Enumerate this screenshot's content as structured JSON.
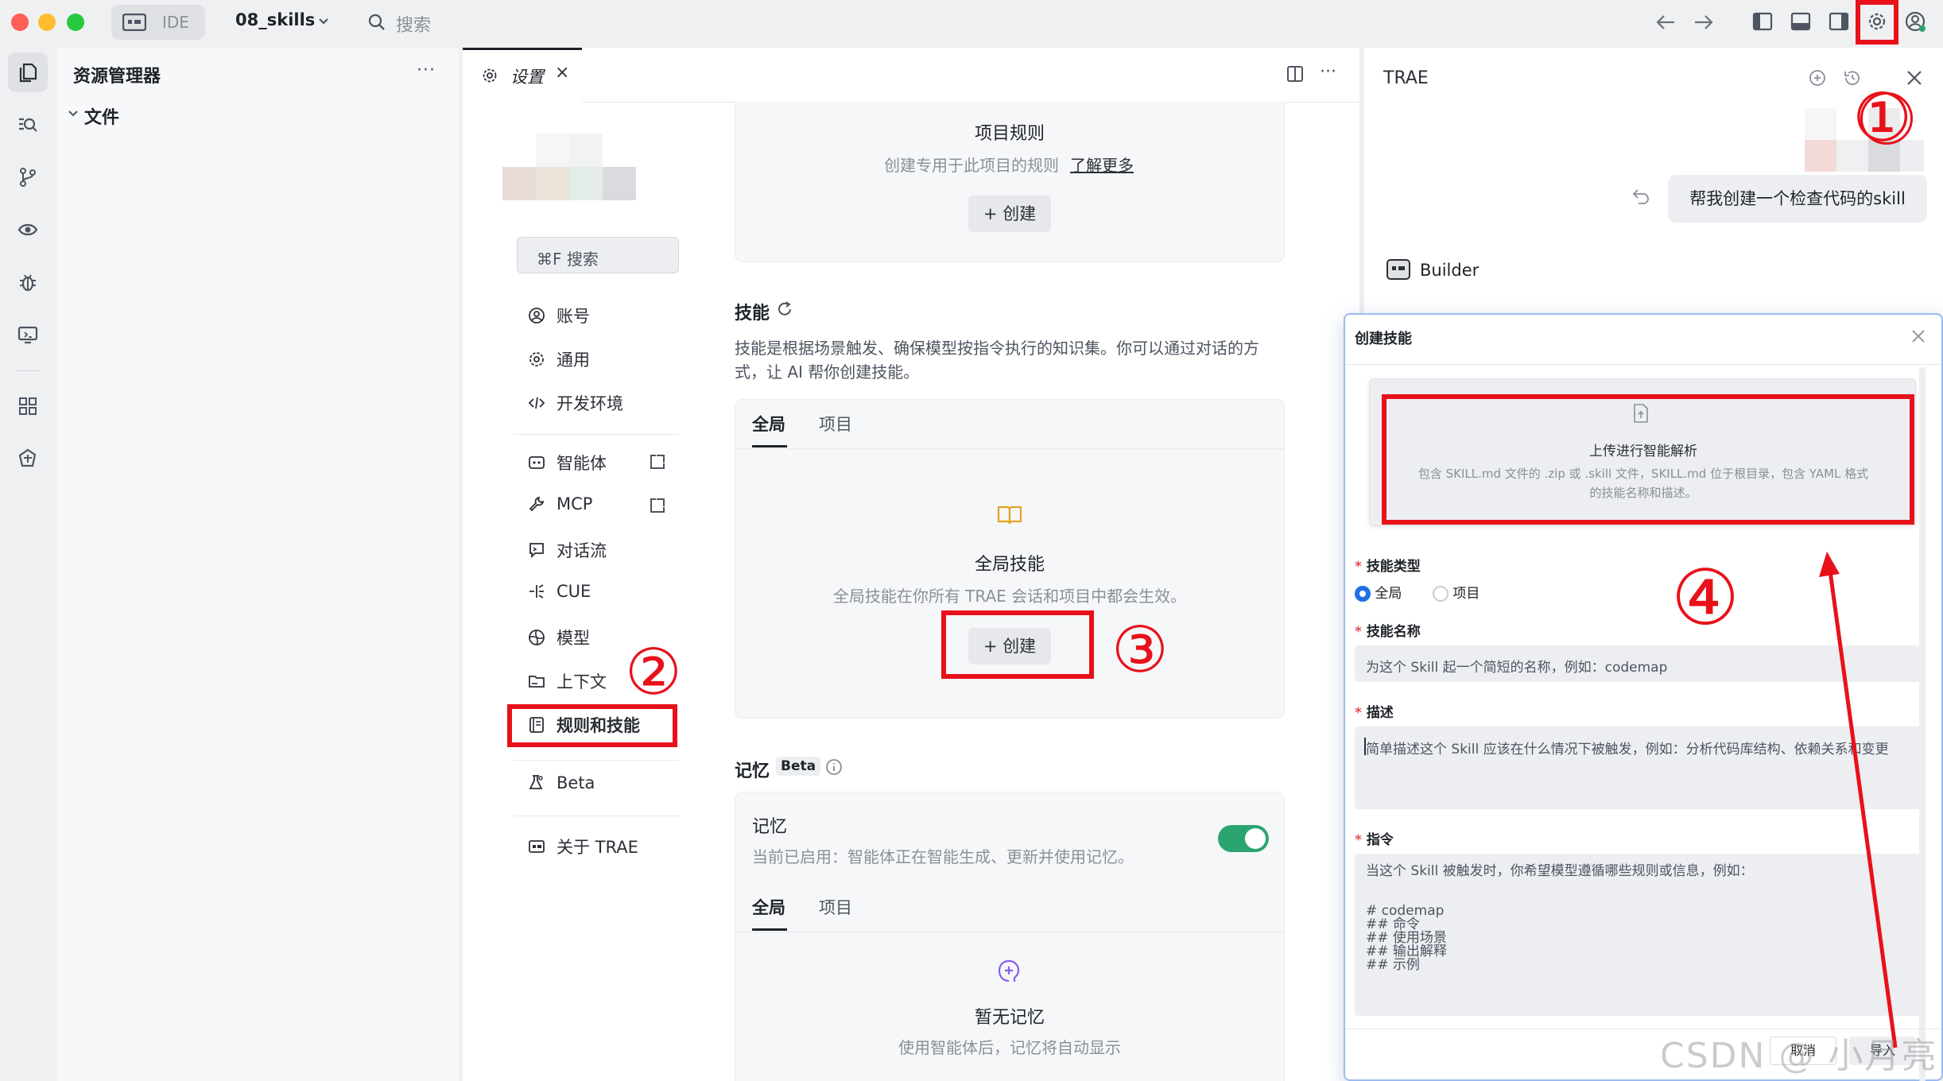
{
  "titlebar": {
    "mode_label": "IDE",
    "project_name": "08_skills",
    "search_placeholder": "搜索"
  },
  "explorer": {
    "title": "资源管理器",
    "more": "···",
    "folder": "文件"
  },
  "editor": {
    "tab_label": "设置",
    "tab_close": "×",
    "settings_search": "⌘F 搜索",
    "nav": [
      {
        "label": "账号",
        "icon": "user-icon"
      },
      {
        "label": "通用",
        "icon": "gear-icon"
      },
      {
        "label": "开发环境",
        "icon": "code-icon"
      },
      {
        "label": "智能体",
        "icon": "agent-icon"
      },
      {
        "label": "MCP",
        "icon": "wrench-icon"
      },
      {
        "label": "对话流",
        "icon": "chat-icon"
      },
      {
        "label": "CUE",
        "icon": "cue-icon"
      },
      {
        "label": "模型",
        "icon": "model-icon"
      },
      {
        "label": "上下文",
        "icon": "folder-icon"
      },
      {
        "label": "规则和技能",
        "icon": "rules-icon"
      },
      {
        "label": "Beta",
        "icon": "flask-icon"
      },
      {
        "label": "关于 TRAE",
        "icon": "info-icon"
      }
    ],
    "project_rules": {
      "title": "项目规则",
      "desc": "创建专用于此项目的规则",
      "learn_more": "了解更多",
      "create": "创建"
    },
    "skills": {
      "title": "技能",
      "desc_line1": "技能是根据场景触发、确保模型按指令执行的知识集。你可以通过对话的方",
      "desc_line2": "式，让 AI 帮你创建技能。",
      "tabs": [
        "全局",
        "项目"
      ],
      "card_title": "全局技能",
      "card_desc": "全局技能在你所有 TRAE 会话和项目中都会生效。",
      "create": "创建"
    },
    "memory": {
      "title": "记忆",
      "badge": "Beta",
      "card_title": "记忆",
      "card_desc": "当前已启用：智能体正在智能生成、更新并使用记忆。",
      "toggle_on": true,
      "tabs": [
        "全局",
        "项目"
      ],
      "empty_title": "暂无记忆",
      "empty_desc": "使用智能体后，记忆将自动显示"
    }
  },
  "chat": {
    "title": "TRAE",
    "user_message": "帮我创建一个检查代码的skill",
    "agent_name": "Builder"
  },
  "dialog": {
    "title": "创建技能",
    "upload_title": "上传进行智能解析",
    "upload_desc_line1": "包含 SKILL.md 文件的 .zip 或 .skill 文件，SKILL.md 位于根目录，包含 YAML 格式",
    "upload_desc_line2": "的技能名称和描述。",
    "type_label": "技能类型",
    "type_options": [
      "全局",
      "项目"
    ],
    "type_selected": "全局",
    "name_label": "技能名称",
    "name_placeholder": "为这个 Skill 起一个简短的名称，例如：codemap",
    "desc_label": "描述",
    "desc_placeholder": "简单描述这个 Skill 应该在什么情况下被触发，例如：分析代码库结构、依赖关系和变更",
    "instr_label": "指令",
    "instr_lines": [
      "当这个 Skill 被触发时，你希望模型遵循哪些规则或信息，例如：",
      "",
      "# codemap",
      "## 命令",
      "## 使用场景",
      "## 输出解释",
      "## 示例"
    ],
    "cancel": "取消",
    "confirm": "导入"
  },
  "annotations": {
    "n1": "①",
    "n2": "②",
    "n3": "③",
    "n4": "④",
    "color": "#e8111a"
  },
  "watermark": "CSDN @ 小月亮"
}
